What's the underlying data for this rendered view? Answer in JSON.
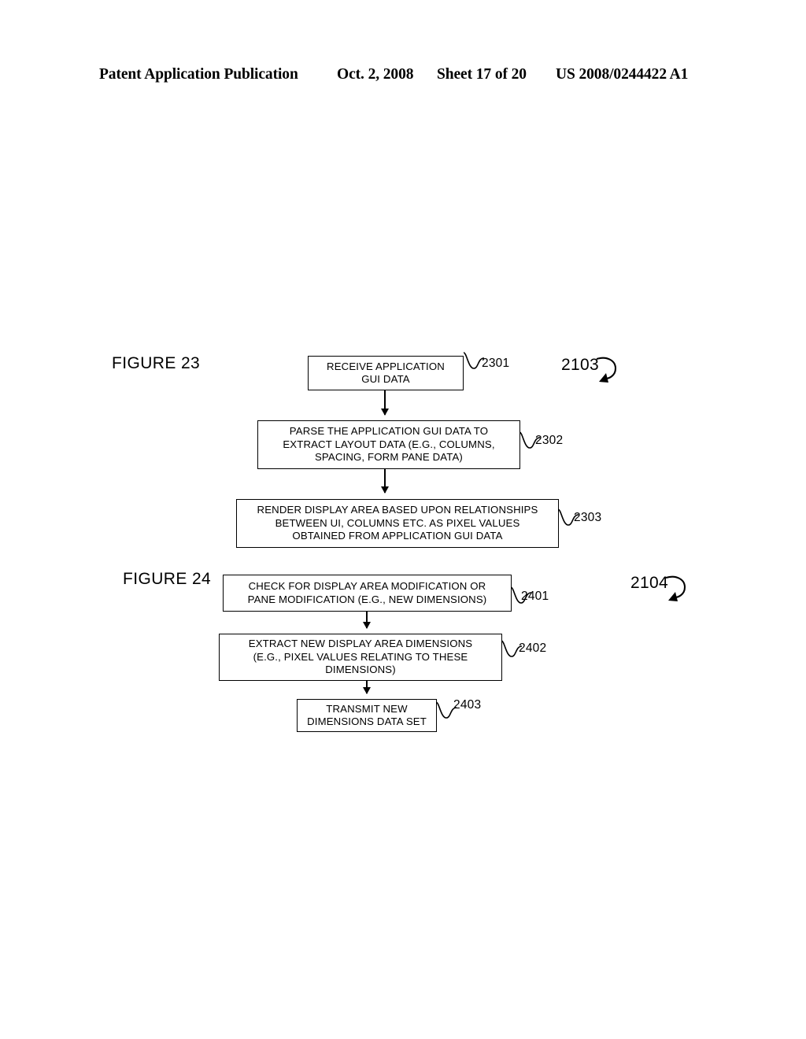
{
  "header": {
    "publication": "Patent Application Publication",
    "date": "Oct. 2, 2008",
    "sheet": "Sheet 17 of 20",
    "patent_number": "US 2008/0244422 A1"
  },
  "figures": [
    {
      "label": "FIGURE 23",
      "group_ref": "2103",
      "steps": [
        {
          "ref": "2301",
          "lines": [
            "RECEIVE APPLICATION",
            "GUI DATA"
          ]
        },
        {
          "ref": "2302",
          "lines": [
            "PARSE THE APPLICATION GUI DATA TO",
            "EXTRACT LAYOUT DATA (E.G., COLUMNS,",
            "SPACING, FORM PANE DATA)"
          ]
        },
        {
          "ref": "2303",
          "lines": [
            "RENDER DISPLAY AREA BASED UPON RELATIONSHIPS",
            "BETWEEN UI, COLUMNS  ETC. AS PIXEL VALUES",
            "OBTAINED FROM APPLICATION GUI DATA"
          ]
        }
      ]
    },
    {
      "label": "FIGURE 24",
      "group_ref": "2104",
      "steps": [
        {
          "ref": "2401",
          "lines": [
            "CHECK FOR DISPLAY AREA MODIFICATION OR",
            "PANE MODIFICATION (E.G., NEW DIMENSIONS)"
          ]
        },
        {
          "ref": "2402",
          "lines": [
            "EXTRACT NEW DISPLAY AREA DIMENSIONS",
            "(E.G., PIXEL VALUES RELATING TO THESE",
            "DIMENSIONS)"
          ]
        },
        {
          "ref": "2403",
          "lines": [
            "TRANSMIT NEW",
            "DIMENSIONS DATA SET"
          ]
        }
      ]
    }
  ],
  "colors": {
    "ink": "#000000",
    "page": "#ffffff"
  }
}
